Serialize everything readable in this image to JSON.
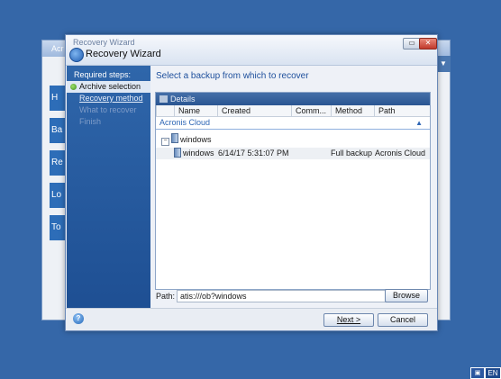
{
  "background_app": {
    "title": "Acr",
    "side_items": [
      "H",
      "Ba",
      "Re",
      "Lo",
      "To"
    ],
    "dropdown_icon": "chevron-down-icon"
  },
  "dialog": {
    "title_small": "Recovery Wizard",
    "title": "Recovery Wizard",
    "restore_icon": "restore-icon",
    "close_icon": "close-icon"
  },
  "steps": {
    "header": "Required steps:",
    "items": [
      {
        "label": "Archive selection",
        "state": "active"
      },
      {
        "label": "Recovery method",
        "state": "link"
      },
      {
        "label": "What to recover",
        "state": "disabled"
      },
      {
        "label": "Finish",
        "state": "disabled"
      }
    ]
  },
  "main": {
    "heading": "Select a backup from which to recover",
    "details_label": "Details",
    "columns": [
      "Name",
      "Created",
      "Comm...",
      "Method",
      "Path"
    ],
    "group": "Acronis Cloud",
    "tree_node": "windows",
    "rows": [
      {
        "name": "windows",
        "created": "6/14/17 5:31:07 PM",
        "comment": "",
        "method": "Full backup",
        "path": "Acronis Cloud"
      }
    ],
    "path_label": "Path:",
    "path_value": "atis:///ob?windows",
    "browse": "Browse"
  },
  "footer": {
    "next": "Next >",
    "cancel": "Cancel"
  },
  "tray": {
    "language": "EN"
  },
  "colors": {
    "desktop": "#3567a8",
    "accent": "#1d4f9c",
    "steps_pane": "#2f66aa"
  }
}
